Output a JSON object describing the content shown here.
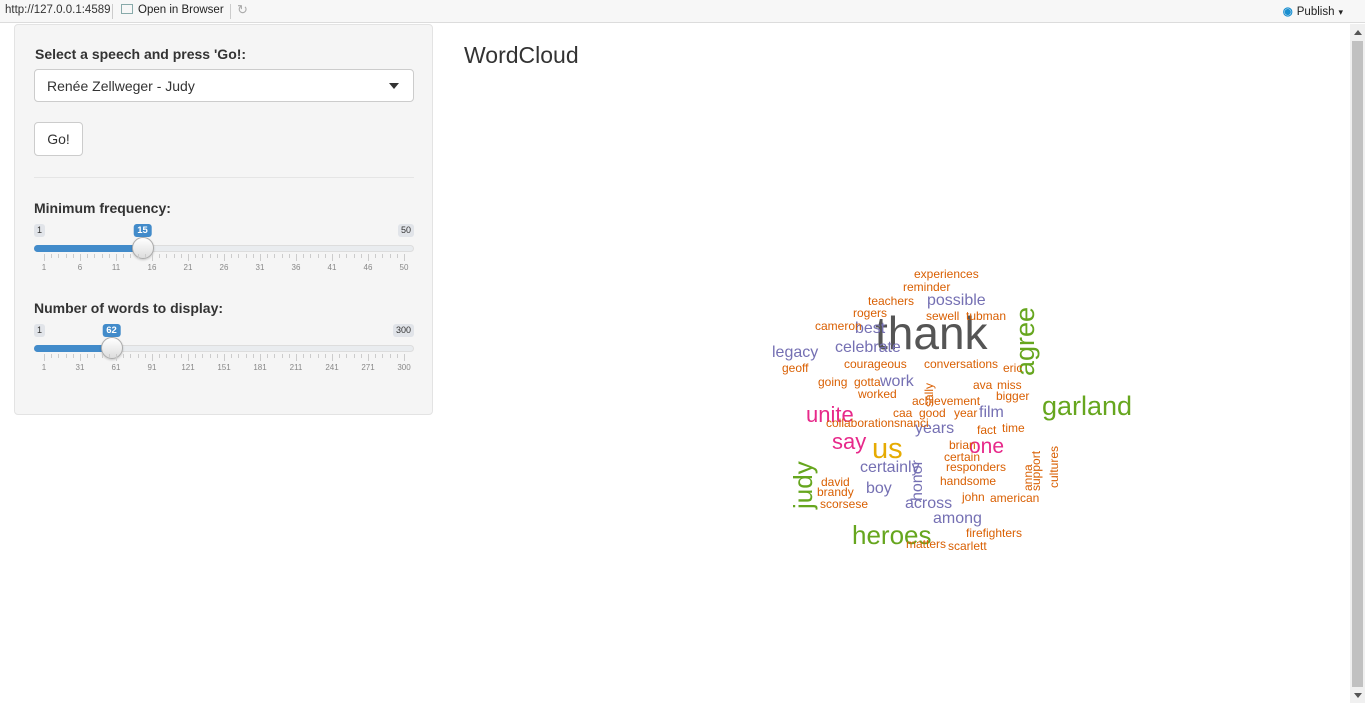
{
  "browser": {
    "url": "http://127.0.0.1:4589",
    "open_in_browser": "Open in Browser",
    "publish": "Publish"
  },
  "sidebar": {
    "select_label": "Select a speech and press 'Go!:",
    "selected_speech": "Renée Zellweger - Judy",
    "go_button": "Go!",
    "min_freq": {
      "label": "Minimum frequency:",
      "min": 1,
      "max": 50,
      "value": 15,
      "min_label": "1",
      "max_label": "50",
      "value_label": "15",
      "tick_labels": [
        "1",
        "6",
        "11",
        "16",
        "21",
        "26",
        "31",
        "36",
        "41",
        "46",
        "50"
      ]
    },
    "num_words": {
      "label": "Number of words to display:",
      "min": 1,
      "max": 300,
      "value": 62,
      "min_label": "1",
      "max_label": "300",
      "value_label": "62",
      "tick_labels": [
        "1",
        "31",
        "61",
        "91",
        "121",
        "151",
        "181",
        "211",
        "241",
        "271",
        "300"
      ]
    }
  },
  "main": {
    "title": "WordCloud"
  },
  "wordcloud": {
    "colors": {
      "dark": "#555555",
      "green": "#66a61e",
      "purple": "#7570b3",
      "orange": "#d95f02",
      "magenta": "#e7298a",
      "gold": "#e6ab02",
      "brown": "#a6761d"
    },
    "words": [
      {
        "text": "thank",
        "color": "dark",
        "size": 46,
        "rot": 0
      },
      {
        "text": "agree",
        "color": "green",
        "size": 27,
        "rot": -90
      },
      {
        "text": "garland",
        "color": "green",
        "size": 27,
        "rot": 0
      },
      {
        "text": "us",
        "color": "gold",
        "size": 29,
        "rot": 0
      },
      {
        "text": "heroes",
        "color": "green",
        "size": 26,
        "rot": 0
      },
      {
        "text": "judy",
        "color": "green",
        "size": 26,
        "rot": -90
      },
      {
        "text": "unite",
        "color": "magenta",
        "size": 22,
        "rot": 0
      },
      {
        "text": "say",
        "color": "magenta",
        "size": 22,
        "rot": 0
      },
      {
        "text": "one",
        "color": "magenta",
        "size": 21,
        "rot": 0
      },
      {
        "text": "possible",
        "color": "purple",
        "size": 16,
        "rot": 0
      },
      {
        "text": "best",
        "color": "purple",
        "size": 16,
        "rot": 0
      },
      {
        "text": "celebrate",
        "color": "purple",
        "size": 16,
        "rot": 0
      },
      {
        "text": "legacy",
        "color": "purple",
        "size": 16,
        "rot": 0
      },
      {
        "text": "work",
        "color": "purple",
        "size": 16,
        "rot": 0
      },
      {
        "text": "years",
        "color": "purple",
        "size": 16,
        "rot": 0
      },
      {
        "text": "film",
        "color": "purple",
        "size": 16,
        "rot": 0
      },
      {
        "text": "honor",
        "color": "purple",
        "size": 16,
        "rot": -90
      },
      {
        "text": "certainly",
        "color": "purple",
        "size": 16,
        "rot": 0
      },
      {
        "text": "boy",
        "color": "purple",
        "size": 16,
        "rot": 0
      },
      {
        "text": "across",
        "color": "purple",
        "size": 16,
        "rot": 0
      },
      {
        "text": "among",
        "color": "purple",
        "size": 16,
        "rot": 0
      },
      {
        "text": "experiences",
        "color": "orange",
        "size": 12,
        "rot": 0
      },
      {
        "text": "reminder",
        "color": "orange",
        "size": 12,
        "rot": 0
      },
      {
        "text": "teachers",
        "color": "orange",
        "size": 12,
        "rot": 0
      },
      {
        "text": "rogers",
        "color": "orange",
        "size": 12,
        "rot": 0
      },
      {
        "text": "sewell",
        "color": "orange",
        "size": 12,
        "rot": 0
      },
      {
        "text": "tubman",
        "color": "orange",
        "size": 12,
        "rot": 0
      },
      {
        "text": "cameron",
        "color": "orange",
        "size": 12,
        "rot": 0
      },
      {
        "text": "geoff",
        "color": "orange",
        "size": 12,
        "rot": 0
      },
      {
        "text": "courageous",
        "color": "orange",
        "size": 12,
        "rot": 0
      },
      {
        "text": "conversations",
        "color": "orange",
        "size": 12,
        "rot": 0
      },
      {
        "text": "eric",
        "color": "orange",
        "size": 12,
        "rot": 0
      },
      {
        "text": "going",
        "color": "orange",
        "size": 12,
        "rot": 0
      },
      {
        "text": "gotta",
        "color": "orange",
        "size": 12,
        "rot": 0
      },
      {
        "text": "sally",
        "color": "orange",
        "size": 12,
        "rot": -90
      },
      {
        "text": "ava",
        "color": "orange",
        "size": 12,
        "rot": 0
      },
      {
        "text": "miss",
        "color": "orange",
        "size": 12,
        "rot": 0
      },
      {
        "text": "worked",
        "color": "orange",
        "size": 12,
        "rot": 0
      },
      {
        "text": "achievement",
        "color": "orange",
        "size": 12,
        "rot": 0
      },
      {
        "text": "bigger",
        "color": "orange",
        "size": 12,
        "rot": 0
      },
      {
        "text": "caa",
        "color": "orange",
        "size": 12,
        "rot": 0
      },
      {
        "text": "good",
        "color": "orange",
        "size": 12,
        "rot": 0
      },
      {
        "text": "year",
        "color": "orange",
        "size": 12,
        "rot": 0
      },
      {
        "text": "collaborations",
        "color": "orange",
        "size": 12,
        "rot": 0
      },
      {
        "text": "nanci",
        "color": "orange",
        "size": 12,
        "rot": 0
      },
      {
        "text": "fact",
        "color": "orange",
        "size": 12,
        "rot": 0
      },
      {
        "text": "time",
        "color": "orange",
        "size": 12,
        "rot": 0
      },
      {
        "text": "support",
        "color": "orange",
        "size": 12,
        "rot": -90
      },
      {
        "text": "cultures",
        "color": "orange",
        "size": 12,
        "rot": -90
      },
      {
        "text": "brian",
        "color": "orange",
        "size": 12,
        "rot": 0
      },
      {
        "text": "certain",
        "color": "orange",
        "size": 12,
        "rot": 0
      },
      {
        "text": "responders",
        "color": "orange",
        "size": 12,
        "rot": 0
      },
      {
        "text": "anna",
        "color": "orange",
        "size": 12,
        "rot": -90
      },
      {
        "text": "david",
        "color": "orange",
        "size": 12,
        "rot": 0
      },
      {
        "text": "handsome",
        "color": "orange",
        "size": 12,
        "rot": 0
      },
      {
        "text": "brandy",
        "color": "orange",
        "size": 12,
        "rot": 0
      },
      {
        "text": "john",
        "color": "orange",
        "size": 12,
        "rot": 0
      },
      {
        "text": "american",
        "color": "orange",
        "size": 12,
        "rot": 0
      },
      {
        "text": "scorsese",
        "color": "orange",
        "size": 12,
        "rot": 0
      },
      {
        "text": "firefighters",
        "color": "orange",
        "size": 12,
        "rot": 0
      },
      {
        "text": "matters",
        "color": "orange",
        "size": 12,
        "rot": 0
      },
      {
        "text": "scarlett",
        "color": "orange",
        "size": 12,
        "rot": 0
      }
    ]
  }
}
